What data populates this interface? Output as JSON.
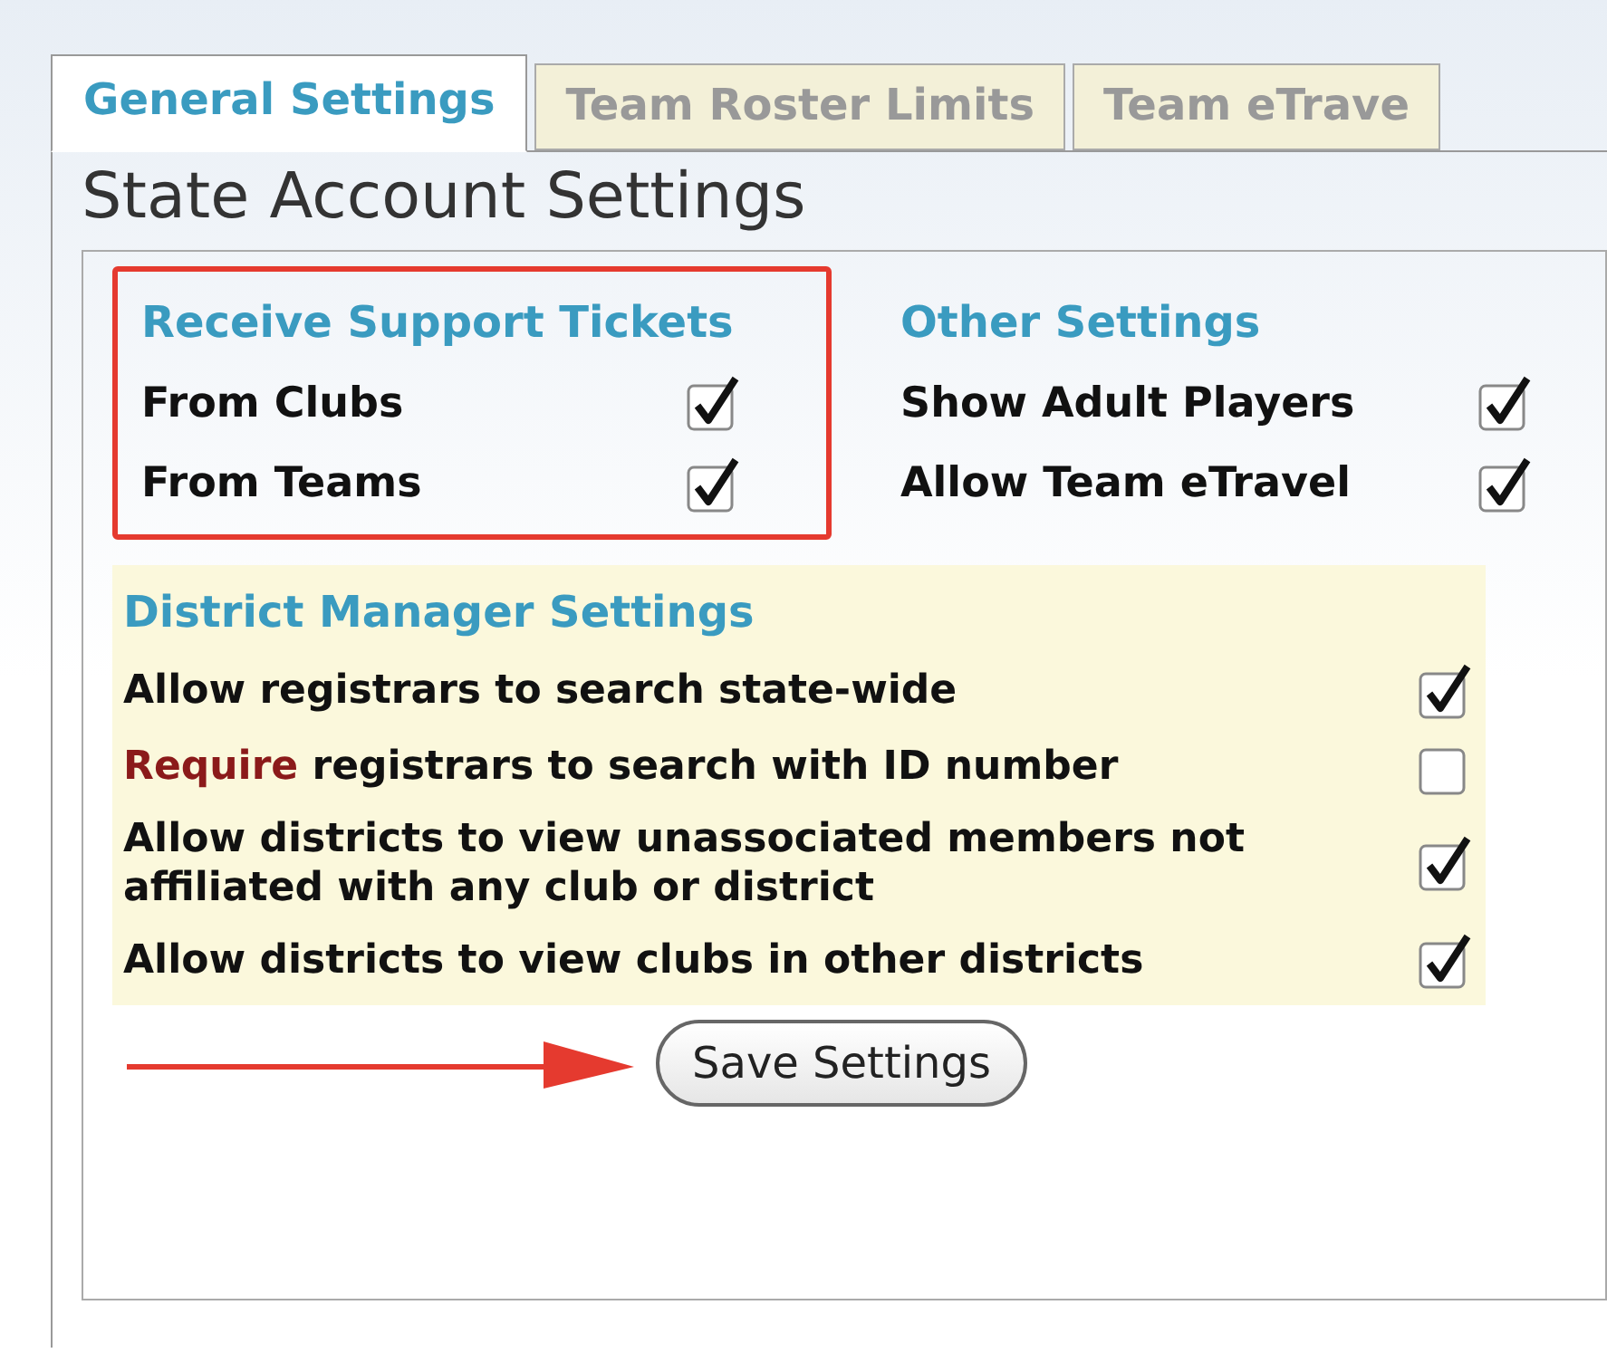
{
  "tabs": [
    {
      "label": "General Settings",
      "selected": true
    },
    {
      "label": "Team Roster Limits",
      "selected": false
    },
    {
      "label": "Team eTrave",
      "selected": false
    }
  ],
  "heading": "State Account Settings",
  "support_tickets": {
    "title": "Receive Support Tickets",
    "items": [
      {
        "label": "From Clubs",
        "checked": true
      },
      {
        "label": "From Teams",
        "checked": true
      }
    ]
  },
  "other_settings": {
    "title": "Other Settings",
    "items": [
      {
        "label": "Show Adult Players",
        "checked": true
      },
      {
        "label": "Allow Team eTravel",
        "checked": true
      }
    ]
  },
  "district_manager": {
    "title": "District Manager Settings",
    "items": [
      {
        "label": "Allow registrars to search state-wide",
        "checked": true
      },
      {
        "emphasis": "Require",
        "label": " registrars to search with ID number",
        "checked": false
      },
      {
        "label": "Allow districts to view unassociated members not affiliated with any club or district",
        "checked": true
      },
      {
        "label": "Allow districts to view clubs in other districts",
        "checked": true
      }
    ]
  },
  "save_button": "Save Settings"
}
